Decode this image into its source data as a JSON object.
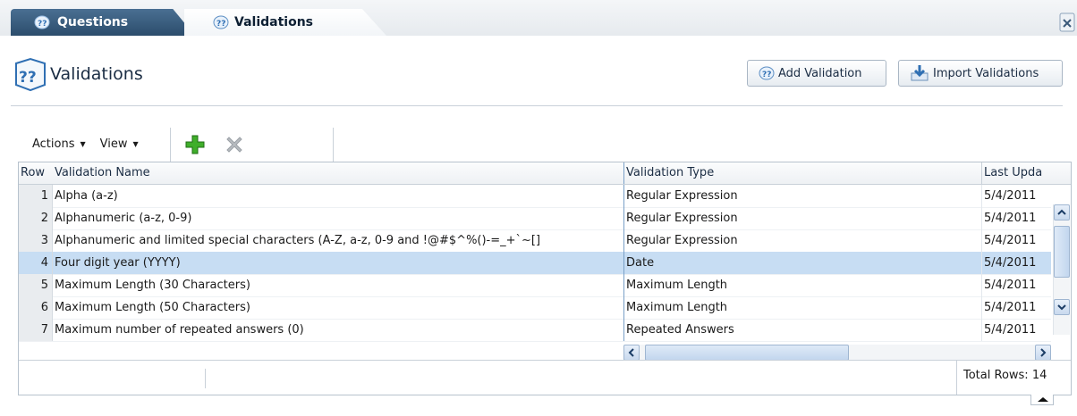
{
  "tabs": [
    {
      "label": "Questions",
      "icon": "question-cube-icon"
    },
    {
      "label": "Validations",
      "icon": "question-cube-icon"
    }
  ],
  "header": {
    "title": "Validations",
    "add_button": "Add Validation",
    "import_button": "Import Validations"
  },
  "toolbar": {
    "actions_label": "Actions",
    "view_label": "View",
    "add_icon": "green-plus-icon",
    "delete_icon": "gray-x-icon"
  },
  "table": {
    "columns": [
      "Row",
      "Validation Name",
      "Validation Type",
      "Last Upda"
    ],
    "rows": [
      {
        "row": "1",
        "name": "Alpha (a-z)",
        "type": "Regular Expression",
        "updated": "5/4/2011"
      },
      {
        "row": "2",
        "name": "Alphanumeric (a-z, 0-9)",
        "type": "Regular Expression",
        "updated": "5/4/2011"
      },
      {
        "row": "3",
        "name": "Alphanumeric and limited special characters (A-Z, a-z, 0-9 and !@#$^%()-=_+`~[]",
        "type": "Regular Expression",
        "updated": "5/4/2011"
      },
      {
        "row": "4",
        "name": "Four digit year (YYYY)",
        "type": "Date",
        "updated": "5/4/2011"
      },
      {
        "row": "5",
        "name": "Maximum Length (30 Characters)",
        "type": "Maximum Length",
        "updated": "5/4/2011"
      },
      {
        "row": "6",
        "name": "Maximum Length (50 Characters)",
        "type": "Maximum Length",
        "updated": "5/4/2011"
      },
      {
        "row": "7",
        "name": "Maximum number of repeated answers (0)",
        "type": "Repeated Answers",
        "updated": "5/4/2011"
      }
    ],
    "selected_row": "4",
    "total_rows": "Total Rows: 14"
  },
  "colors": {
    "selected_row": "#c7ddf3",
    "tab_dark": "#2c4d6c",
    "accent_blue": "#2f6fb3"
  }
}
